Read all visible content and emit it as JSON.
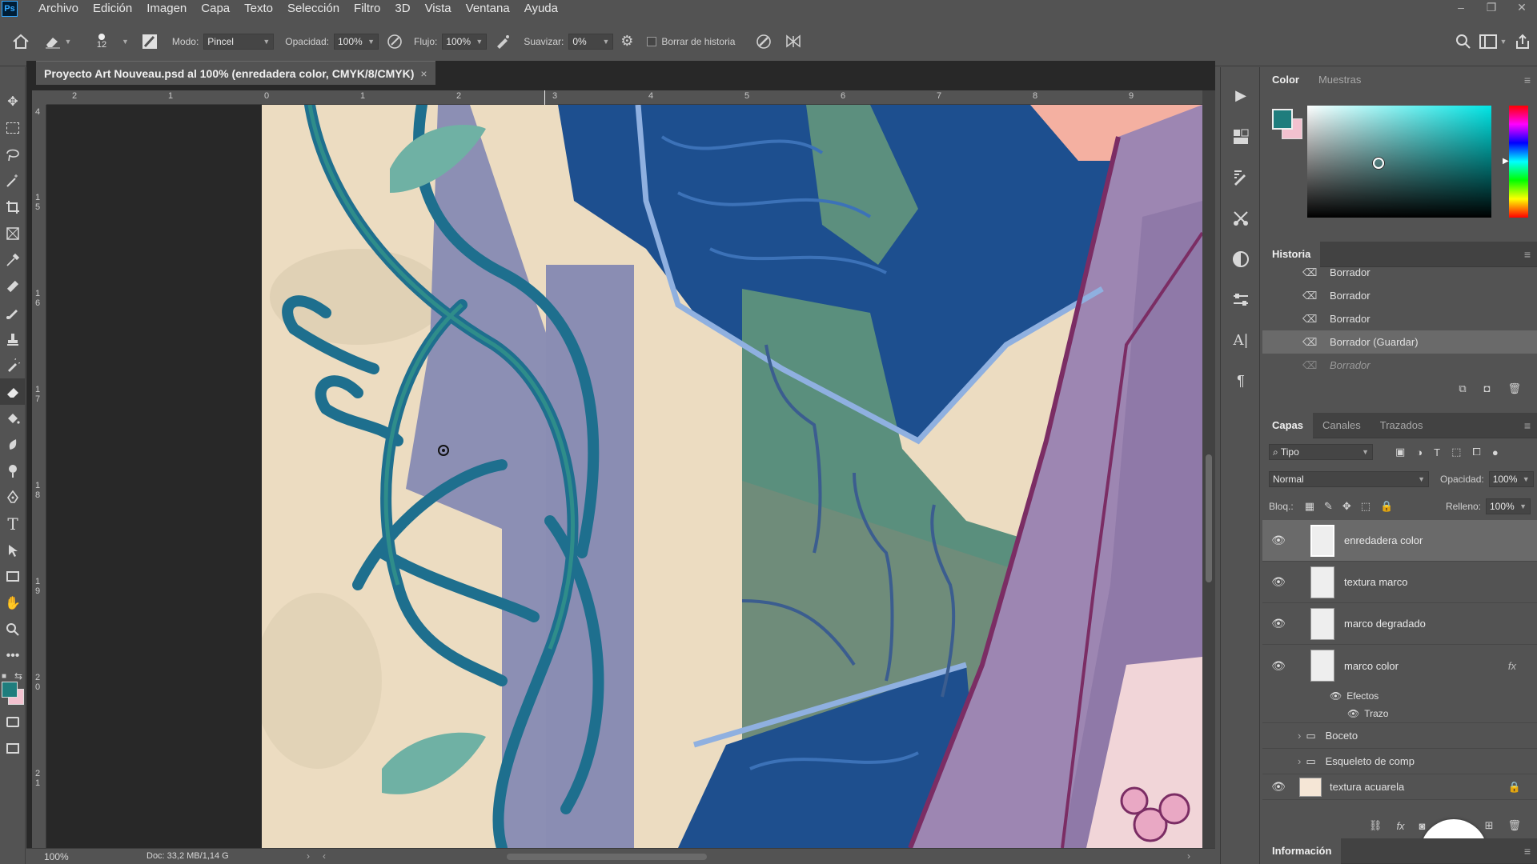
{
  "app": {
    "logo": "Ps",
    "menu": [
      "Archivo",
      "Edición",
      "Imagen",
      "Capa",
      "Texto",
      "Selección",
      "Filtro",
      "3D",
      "Vista",
      "Ventana",
      "Ayuda"
    ]
  },
  "options": {
    "brush_size": "12",
    "mode_label": "Modo:",
    "mode_value": "Pincel",
    "opacity_label": "Opacidad:",
    "opacity_value": "100%",
    "flow_label": "Flujo:",
    "flow_value": "100%",
    "smooth_label": "Suavizar:",
    "smooth_value": "0%",
    "erase_history_label": "Borrar de historia"
  },
  "document": {
    "tab_title": "Proyecto Art Nouveau.psd al 100% (enredadera color, CMYK/8/CMYK)",
    "close": "×",
    "ruler_h": [
      "2",
      "1",
      "0",
      "1",
      "2",
      "3",
      "4",
      "5",
      "6",
      "7",
      "8",
      "9"
    ],
    "ruler_v": [
      "4",
      "1\n5",
      "1\n6",
      "1\n7",
      "1\n8",
      "1\n9",
      "2\n0",
      "2\n1"
    ],
    "zoom": "100%",
    "doc_size": "Doc: 33,2 MB/1,14 G"
  },
  "color_panel": {
    "tabs": [
      "Color",
      "Muestras"
    ],
    "foreground": "#1f7d7d",
    "background": "#f2c1cf"
  },
  "history": {
    "tab": "Historia",
    "items": [
      {
        "label": "Borrador",
        "state": "normal"
      },
      {
        "label": "Borrador",
        "state": "normal"
      },
      {
        "label": "Borrador",
        "state": "normal"
      },
      {
        "label": "Borrador (Guardar)",
        "state": "selected"
      },
      {
        "label": "Borrador",
        "state": "dim"
      }
    ]
  },
  "layers": {
    "tabs": [
      "Capas",
      "Canales",
      "Trazados"
    ],
    "filter_kind": "Tipo",
    "blend_mode": "Normal",
    "opacity_label": "Opacidad:",
    "opacity_value": "100%",
    "lock_label": "Bloq.:",
    "fill_label": "Relleno:",
    "fill_value": "100%",
    "items": [
      {
        "name": "enredadera color",
        "visible": true,
        "selected": true
      },
      {
        "name": "textura marco",
        "visible": true,
        "selected": false
      },
      {
        "name": "marco degradado",
        "visible": true,
        "selected": false
      },
      {
        "name": "marco color",
        "visible": true,
        "selected": false,
        "fx": "fx"
      }
    ],
    "effects_label": "Efectos",
    "stroke_label": "Trazo",
    "groups": [
      "Boceto",
      "Esqueleto de comp"
    ],
    "last_layer": "textura acuarela"
  },
  "info_panel": {
    "tab": "Información"
  }
}
